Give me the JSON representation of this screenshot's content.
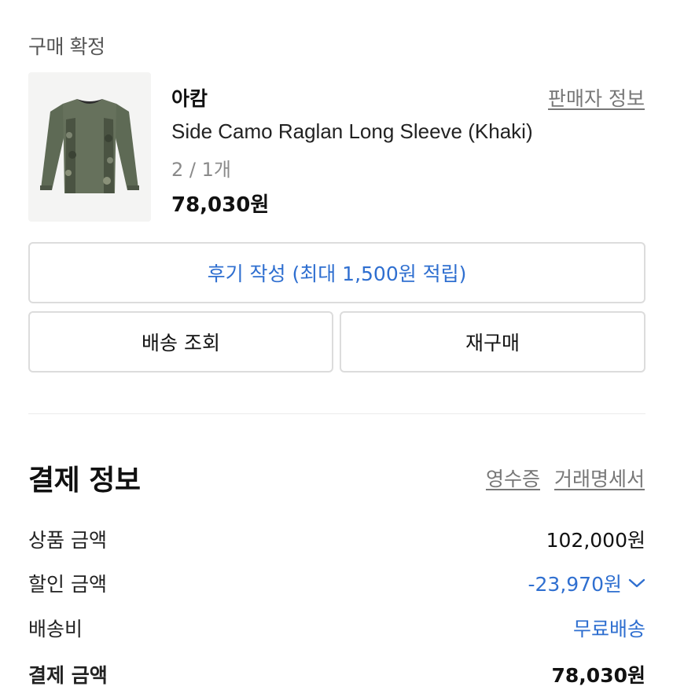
{
  "order": {
    "status_label": "구매 확정",
    "brand": "아캄",
    "seller_link": "판매자 정보",
    "product_name": "Side Camo Raglan Long Sleeve (Khaki)",
    "option": "2 / 1개",
    "price": "78,030원"
  },
  "actions": {
    "review_label": "후기 작성 (최대 1,500원 적립)",
    "delivery_label": "배송 조회",
    "rebuy_label": "재구매"
  },
  "payment": {
    "title": "결제 정보",
    "receipt_link": "영수증",
    "statement_link": "거래명세서",
    "rows": [
      {
        "label": "상품 금액",
        "value": "102,000원"
      },
      {
        "label": "할인 금액",
        "value": "-23,970원"
      },
      {
        "label": "배송비",
        "value": "무료배송"
      },
      {
        "label": "결제 금액",
        "value": "78,030원"
      }
    ]
  },
  "colors": {
    "accent_blue": "#2f6fd0",
    "muted_text": "#777777",
    "border": "#dcdcdc",
    "shirt_khaki": "#5e6a55"
  },
  "icons": {
    "discount_toggle": "chevron-down-icon",
    "product_image": "long-sleeve-shirt-thumbnail"
  }
}
